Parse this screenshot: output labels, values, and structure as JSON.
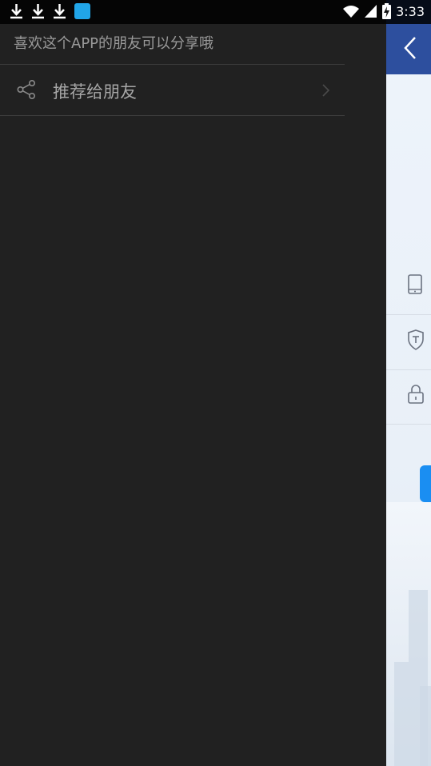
{
  "status_bar": {
    "time": "3:33",
    "icons": [
      "download-icon",
      "download-icon",
      "download-icon",
      "app-notification-icon",
      "wifi-icon",
      "signal-icon",
      "battery-charging-icon"
    ]
  },
  "drawer": {
    "hint": "喜欢这个APP的朋友可以分享哦",
    "items": [
      {
        "label": "推荐给朋友",
        "icon": "share-icon"
      }
    ]
  },
  "colors": {
    "drawer_bg": "#212121",
    "header_blue": "#2d4f9e",
    "accent_blue": "#1a8ef2",
    "text_gray": "#a6a6a6"
  }
}
